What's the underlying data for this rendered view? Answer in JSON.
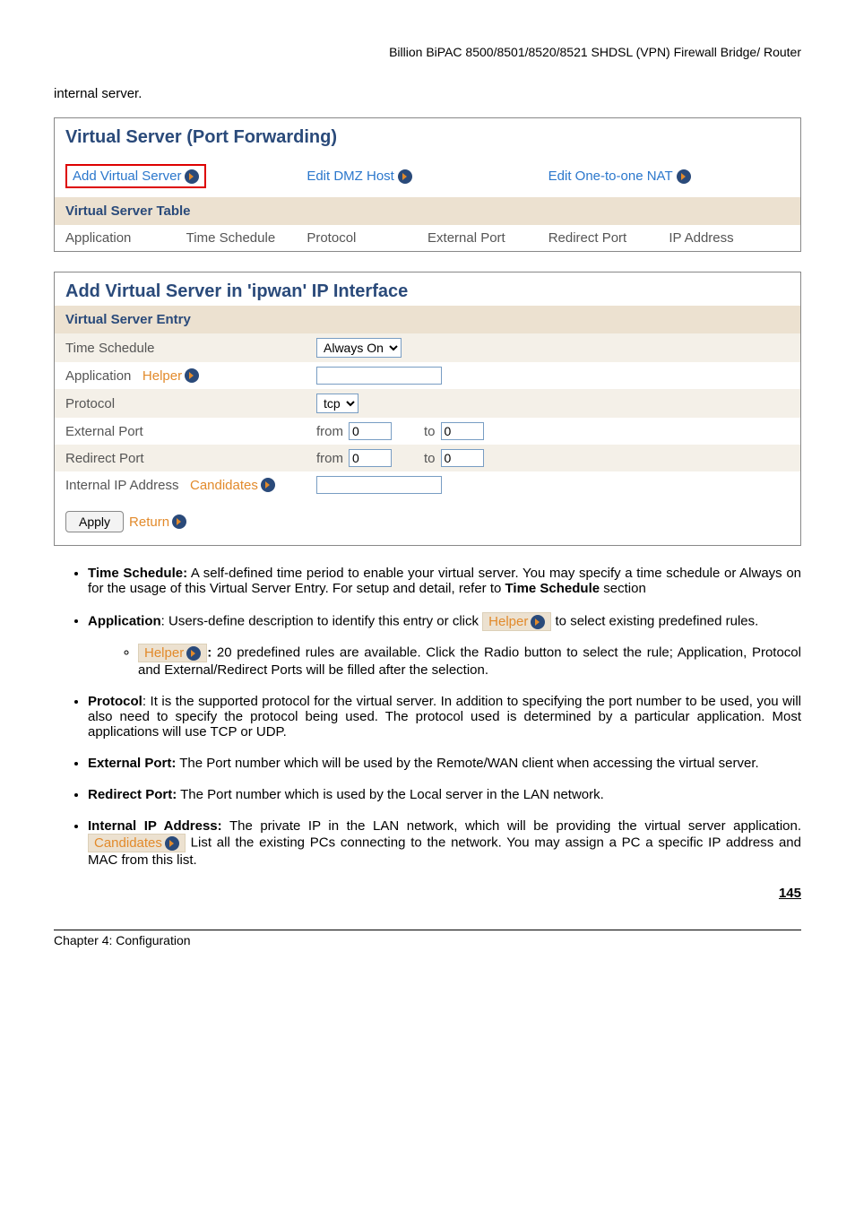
{
  "header": "Billion BiPAC 8500/8501/8520/8521 SHDSL (VPN) Firewall Bridge/ Router",
  "intro": "internal server.",
  "panel1": {
    "title": "Virtual Server (Port Forwarding)",
    "links": {
      "add": "Add Virtual Server",
      "dmz": "Edit DMZ Host",
      "nat": "Edit One-to-one NAT"
    },
    "table_banner": "Virtual Server Table",
    "cols": {
      "c1": "Application",
      "c2": "Time Schedule",
      "c3": "Protocol",
      "c4": "External Port",
      "c5": "Redirect Port",
      "c6": "IP Address"
    }
  },
  "panel2": {
    "title": "Add Virtual Server in 'ipwan' IP Interface",
    "banner": "Virtual Server Entry",
    "rows": {
      "time_label": "Time Schedule",
      "time_value": "Always On",
      "app_label": "Application",
      "app_helper": "Helper",
      "proto_label": "Protocol",
      "proto_value": "tcp",
      "ext_label": "External Port",
      "ext_from_lbl": "from",
      "ext_from_val": "0",
      "ext_to_lbl": "to",
      "ext_to_val": "0",
      "redir_label": "Redirect Port",
      "redir_from_lbl": "from",
      "redir_from_val": "0",
      "redir_to_lbl": "to",
      "redir_to_val": "0",
      "ip_label": "Internal IP Address",
      "ip_cand": "Candidates"
    },
    "apply": "Apply",
    "return": "Return"
  },
  "bullets": {
    "b1_strong": "Time Schedule:",
    "b1_text": " A self-defined time period to enable your virtual server.  You may specify a time schedule or Always on for the usage of this Virtual Server Entry.  For setup and detail, refer to ",
    "b1_strong2": "Time Schedule",
    "b1_text2": " section",
    "b2_strong": "Application",
    "b2_text1": ": Users-define description to identify this entry or click ",
    "b2_badge": "Helper",
    "b2_text2": " to select existing predefined rules.",
    "b2_sub_badge": "Helper",
    "b2_sub_strong": ":",
    "b2_sub_text": " 20 predefined rules are available.  Click the Radio button to select the rule; Application, Protocol and External/Redirect Ports will be filled after the selection.",
    "b3_strong": "Protocol",
    "b3_text": ": It is the supported protocol for the virtual server. In addition to specifying the port number to be used, you will also need to specify the protocol being used. The protocol used is determined by a particular application. Most applications will use TCP or UDP.",
    "b4_strong": "External Port:",
    "b4_text": " The Port number which will be used by the Remote/WAN client when accessing the virtual server.",
    "b5_strong": "Redirect Port:",
    "b5_text": " The Port number which is used by the Local server in the LAN network.",
    "b6_strong": "Internal IP Address:",
    "b6_text1": " The private IP in the LAN network, which will be providing the virtual server application. ",
    "b6_badge": "Candidates",
    "b6_text2": " List all the existing PCs connecting to the network. You may assign a PC a specific IP address and MAC from this list."
  },
  "page_num": "145",
  "footer": "Chapter 4: Configuration"
}
